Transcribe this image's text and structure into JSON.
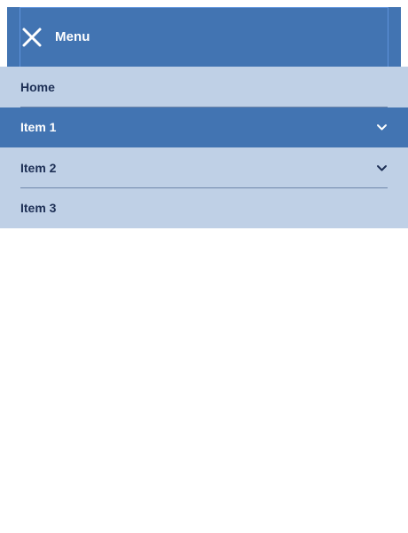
{
  "header": {
    "toggle_icon": "close-icon",
    "title": "Menu"
  },
  "nav": {
    "items": [
      {
        "label": "Home",
        "has_children": false,
        "active": false
      },
      {
        "label": "Item 1",
        "has_children": true,
        "active": true,
        "chevron_icon": "chevron-down-icon"
      },
      {
        "label": "Item 2",
        "has_children": true,
        "active": false,
        "chevron_icon": "chevron-down-icon"
      },
      {
        "label": "Item 3",
        "has_children": false,
        "active": false
      }
    ]
  },
  "colors": {
    "primary": "#4274b2",
    "submenu_bg": "#bfd0e6",
    "text_dark": "#1d2f55",
    "text_light": "#ffffff",
    "divider": "#6f87ab"
  }
}
